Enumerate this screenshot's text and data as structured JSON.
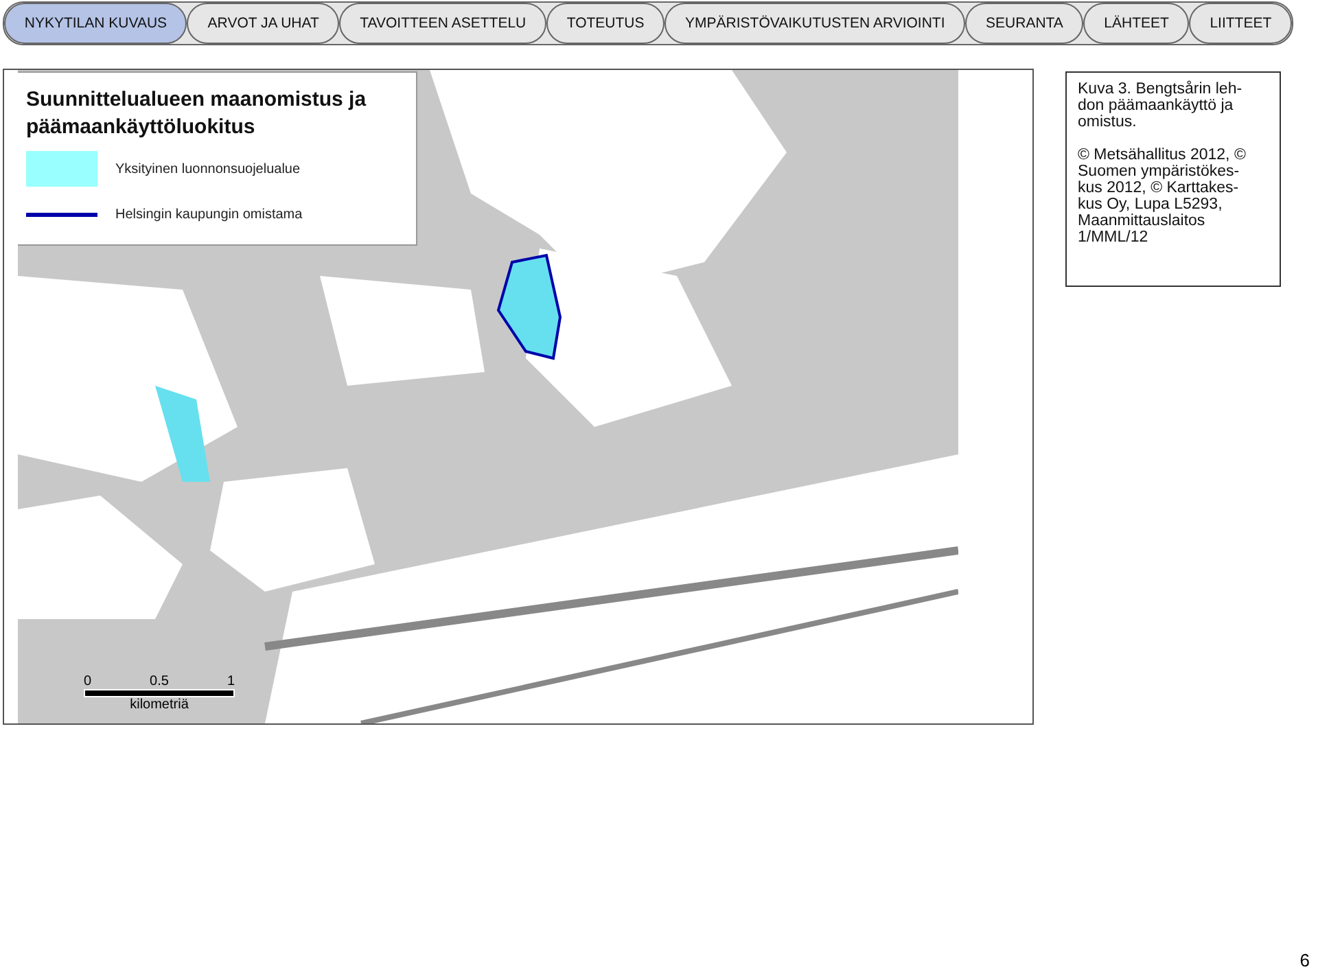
{
  "tabs": [
    {
      "label": "NYKYTILAN KUVAUS",
      "selected": true
    },
    {
      "label": "ARVOT JA UHAT",
      "selected": false
    },
    {
      "label": "TAVOITTEEN ASETTELU",
      "selected": false
    },
    {
      "label": "TOTEUTUS",
      "selected": false
    },
    {
      "label": "YMPÄRISTÖVAIKUTUSTEN ARVIOINTI",
      "selected": false
    },
    {
      "label": "SEURANTA",
      "selected": false
    },
    {
      "label": "LÄHTEET",
      "selected": false
    },
    {
      "label": "LIITTEET",
      "selected": false
    }
  ],
  "legend": {
    "title": "Suunnittelualueen maanomistus ja päämaankäyttöluokitus",
    "items": [
      {
        "kind": "area",
        "color": "#99ffff",
        "label": "Yksityinen luonnonsuojelualue"
      },
      {
        "kind": "line",
        "color": "#0000aa",
        "label": "Helsingin kaupungin omistama"
      }
    ]
  },
  "scale": {
    "ticks": [
      "0",
      "0.5",
      "1"
    ],
    "unit": "kilometriä"
  },
  "caption": {
    "paragraphs": [
      [
        "Kuva 3. Bengtsårin leh-",
        "don päämaankäyttö ja",
        "omistus."
      ],
      [
        "© Metsähallitus 2012, ©",
        "Suomen ympäristökes-",
        "kus 2012, © Karttakes-",
        "kus Oy, Lupa L5293,",
        "Maanmittauslaitos",
        "1/MML/12"
      ]
    ]
  },
  "page_number": "6"
}
